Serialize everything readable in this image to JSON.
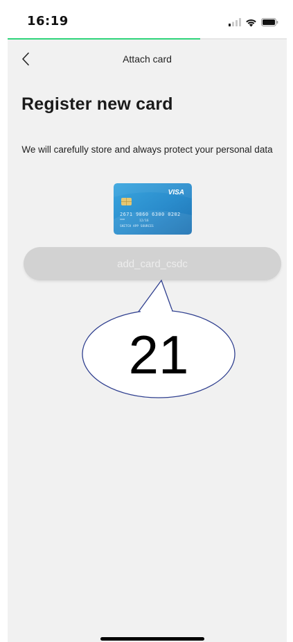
{
  "status_bar": {
    "time": "16:19",
    "icons": [
      "signal-icon",
      "wifi-icon",
      "battery-icon"
    ]
  },
  "progress": {
    "fraction": 0.69,
    "color": "#2ed47a"
  },
  "nav": {
    "title": "Attach card",
    "back_icon": "chevron-left-icon"
  },
  "page": {
    "title": "Register new card",
    "subtitle": "We will carefully store and always protect your personal data"
  },
  "card": {
    "brand": "VISA",
    "number": "2671 9860 6300 0202",
    "small_text": "0000",
    "expiry": "12/16",
    "holder": "SKETCH APP SOURCES",
    "color": "#2b8fcf"
  },
  "button": {
    "label": "add_card_csdc",
    "background": "#d2d2d2"
  },
  "callout": {
    "number": "21"
  }
}
